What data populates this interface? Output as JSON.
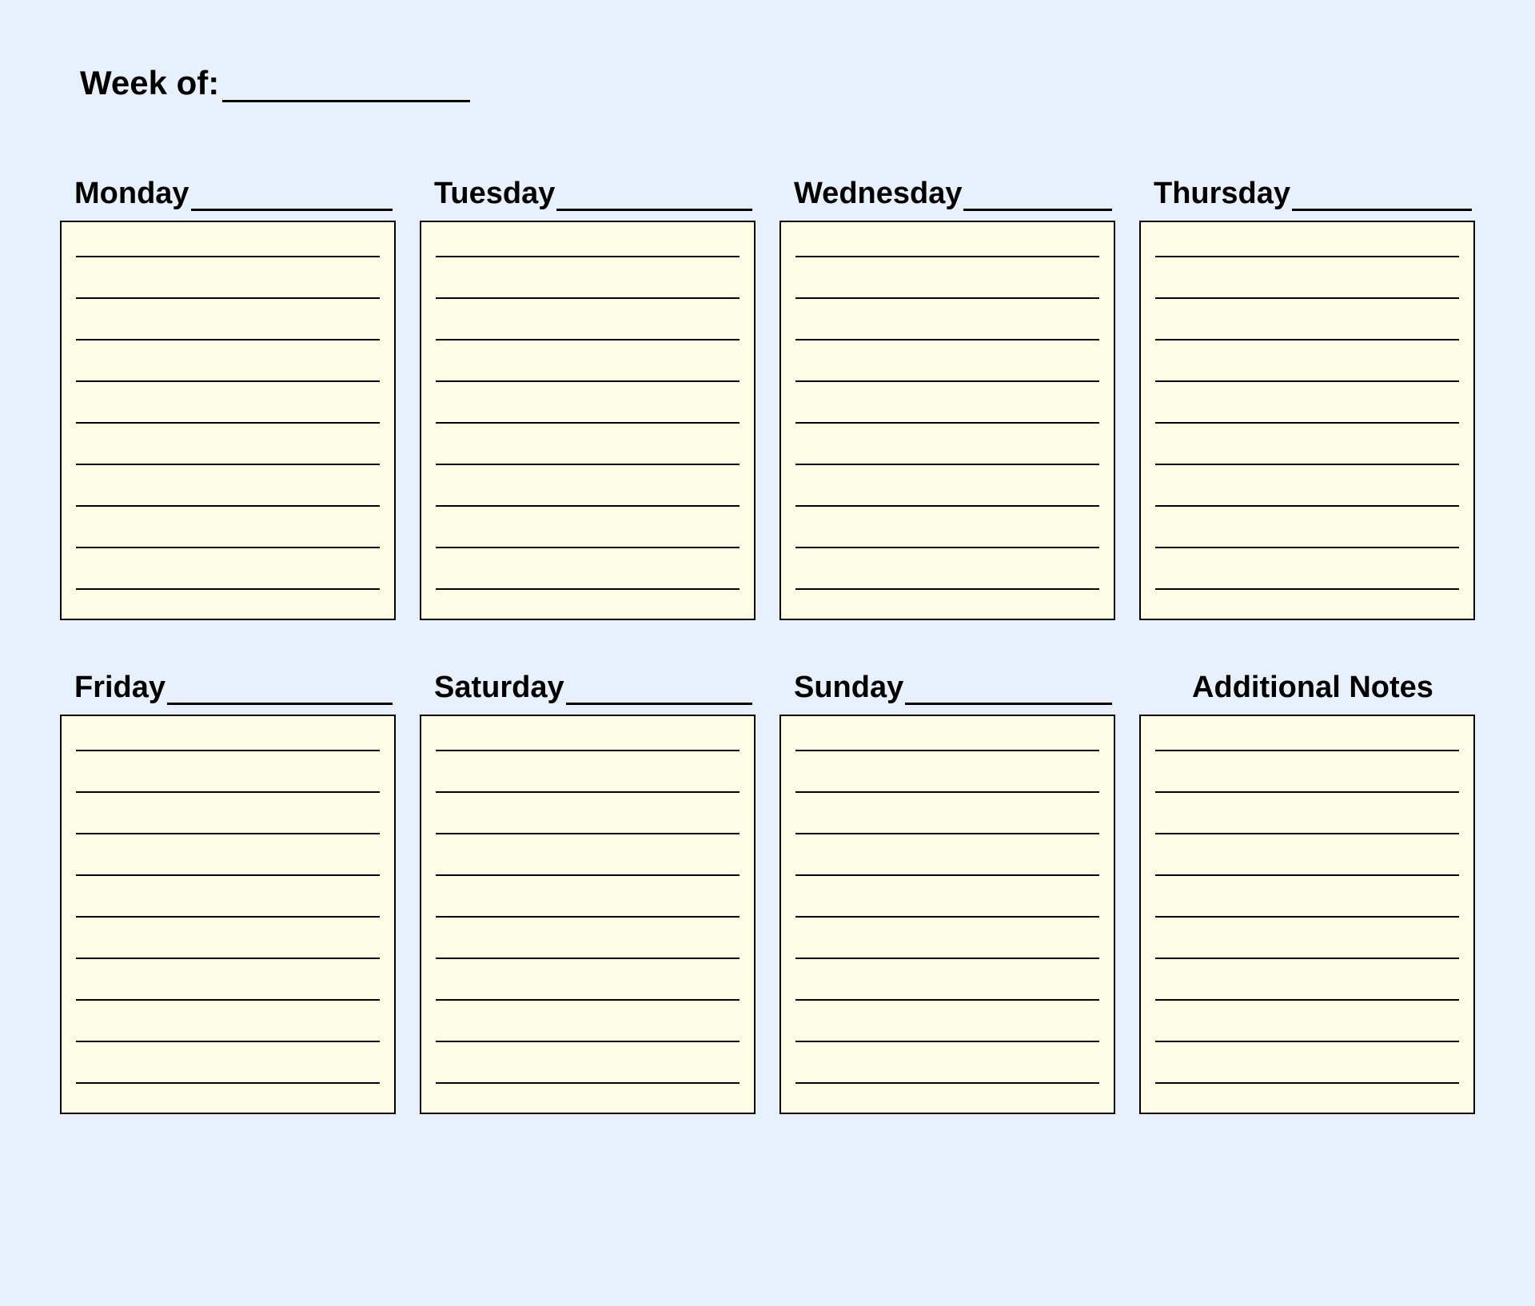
{
  "header": {
    "week_of_label": "Week of:"
  },
  "cells": [
    {
      "label": "Monday",
      "underline": true,
      "lines": 9
    },
    {
      "label": "Tuesday",
      "underline": true,
      "lines": 9
    },
    {
      "label": "Wednesday",
      "underline": true,
      "lines": 9
    },
    {
      "label": "Thursday",
      "underline": true,
      "lines": 9
    },
    {
      "label": "Friday",
      "underline": true,
      "lines": 9
    },
    {
      "label": "Saturday",
      "underline": true,
      "lines": 9
    },
    {
      "label": "Sunday",
      "underline": true,
      "lines": 9
    },
    {
      "label": "Additional Notes",
      "underline": false,
      "lines": 9
    }
  ]
}
